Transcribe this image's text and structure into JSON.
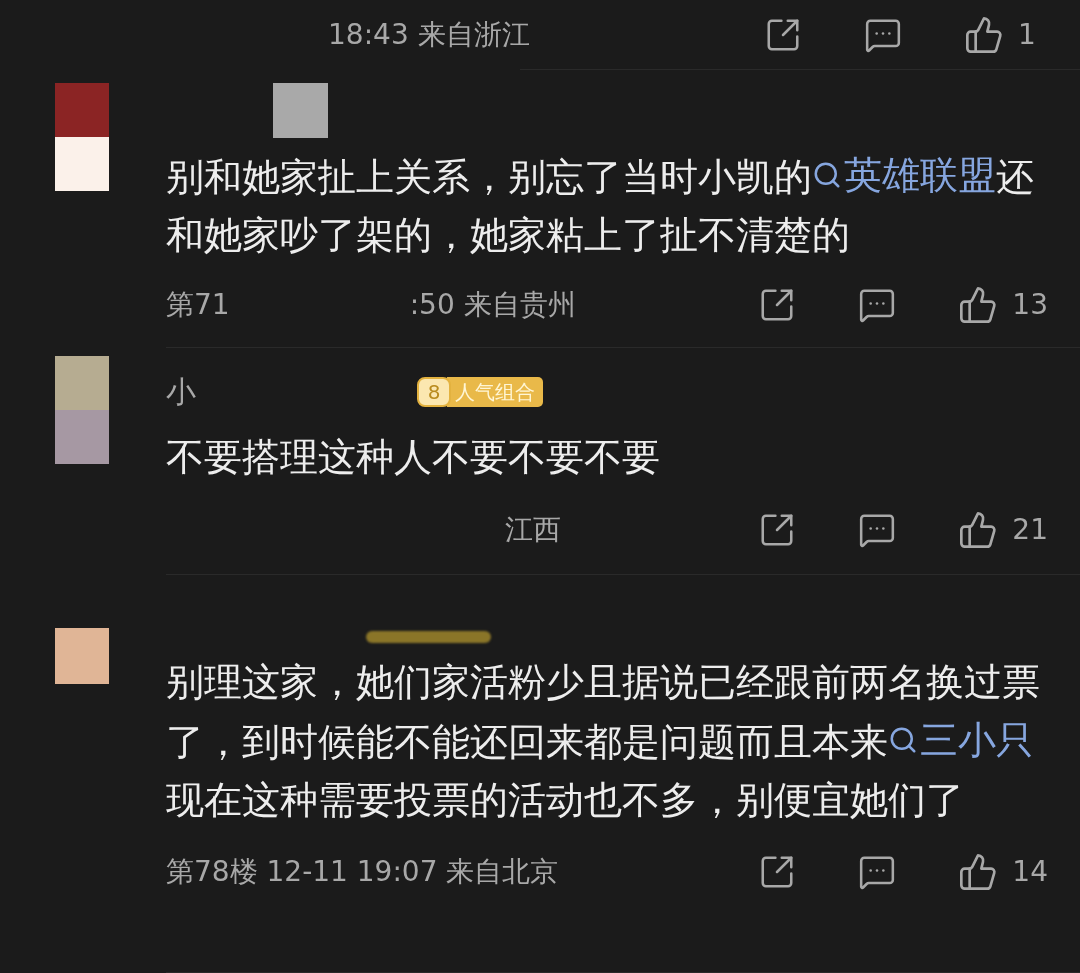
{
  "top_row": {
    "meta": "18:43 来自浙江",
    "like_count": "1"
  },
  "comments": [
    {
      "segments": [
        {
          "kind": "text",
          "text": "别和她家扯上关系，别忘了当时小凯的"
        },
        {
          "kind": "topic",
          "text": "英雄联盟"
        },
        {
          "kind": "text",
          "text": "还和她家吵了架的，她家粘上了扯不清楚的"
        }
      ],
      "meta": [
        "第71",
        ":50 来自贵州"
      ],
      "like_count": "13"
    },
    {
      "name": "小",
      "badge": {
        "rank": "8",
        "label": "人气组合"
      },
      "segments": [
        {
          "kind": "text",
          "text": "不要搭理这种人不要不要不要"
        }
      ],
      "meta": [
        "江西"
      ],
      "like_count": "21"
    },
    {
      "segments": [
        {
          "kind": "text",
          "text": "别理这家，她们家活粉少且据说已经跟前两名换过票了，到时候能不能还回来都是问题而且本来"
        },
        {
          "kind": "topic",
          "text": "三小只"
        },
        {
          "kind": "text",
          "text": " 现在这种需要投票的活动也不多，别便宜她们了"
        }
      ],
      "meta": [
        "第78楼 12-11 19:07 来自北京"
      ],
      "like_count": "14"
    }
  ]
}
